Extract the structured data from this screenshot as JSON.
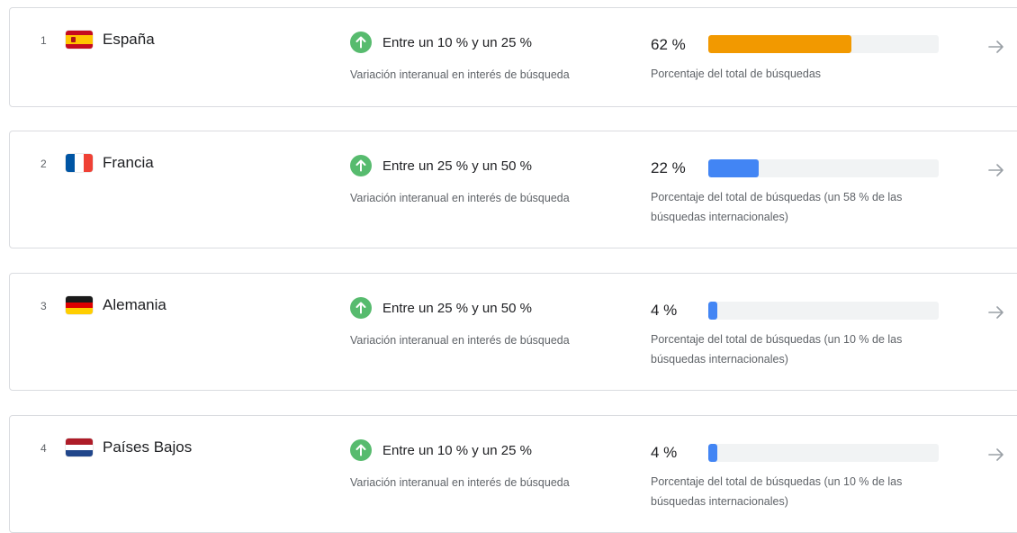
{
  "rows": [
    {
      "rank": "1",
      "country": "España",
      "flag": "spain-flag",
      "range": "Entre un 10 % y un 25 %",
      "range_subtitle": "Variación interanual en interés de búsqueda",
      "percent": "62 %",
      "share_fraction": 0.62,
      "share_label": "Porcentaje del total de búsquedas",
      "bar_color": "#f29900"
    },
    {
      "rank": "2",
      "country": "Francia",
      "flag": "france-flag",
      "range": "Entre un 25 % y un 50 %",
      "range_subtitle": "Variación interanual en interés de búsqueda",
      "percent": "22 %",
      "share_fraction": 0.22,
      "share_label": "Porcentaje del total de búsquedas (un 58 % de las búsquedas internacionales)",
      "bar_color": "#4285f4"
    },
    {
      "rank": "3",
      "country": "Alemania",
      "flag": "germany-flag",
      "range": "Entre un 25 % y un 50 %",
      "range_subtitle": "Variación interanual en interés de búsqueda",
      "percent": "4 %",
      "share_fraction": 0.04,
      "share_label": "Porcentaje del total de búsquedas (un 10 % de las búsquedas internacionales)",
      "bar_color": "#4285f4"
    },
    {
      "rank": "4",
      "country": "Países Bajos",
      "flag": "netherlands-flag",
      "range": "Entre un 10 % y un 25 %",
      "range_subtitle": "Variación interanual en interés de búsqueda",
      "percent": "4 %",
      "share_fraction": 0.04,
      "share_label": "Porcentaje del total de búsquedas (un 10 % de las búsquedas internacionales)",
      "bar_color": "#4285f4"
    }
  ],
  "icons": {
    "trend": "arrow-up-circle-icon",
    "open": "arrow-right-icon"
  },
  "colors": {
    "trend_up": "#57bb6e",
    "arrow": "#9aa0a6"
  }
}
